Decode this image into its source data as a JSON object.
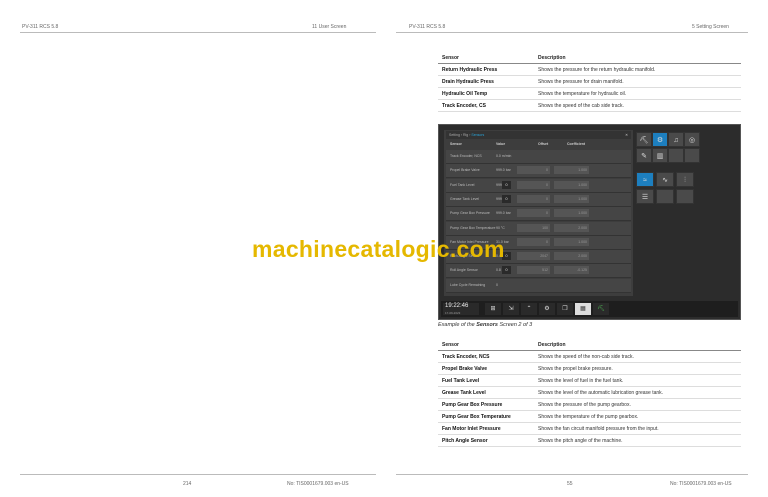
{
  "header": {
    "left_doc": "PV-311 RCS 5.8",
    "left_section": "11 User Screen",
    "right_doc": "PV-311 RCS 5.8",
    "right_section": "5 Setting Screen"
  },
  "table1": {
    "col_sensor": "Sensor",
    "col_desc": "Description",
    "rows": [
      {
        "sensor": "Return Hydraulic Press",
        "desc": "Shows the pressure for the return hydraulic manifold."
      },
      {
        "sensor": "Drain Hydraulic Press",
        "desc": "Shows the pressure for drain manifold."
      },
      {
        "sensor": "Hydraulic Oil Temp",
        "desc": "Shows the temperature for hydraulic oil."
      },
      {
        "sensor": "Track Encoder, CS",
        "desc": "Shows the speed of the cab side track."
      }
    ]
  },
  "screen": {
    "breadcrumb_prefix": "Setting › Rig ›",
    "breadcrumb_active": "Sensors",
    "col_sensor": "Sensor",
    "col_value": "Value",
    "col_offset": "Offset",
    "col_coeff": "Coefficient",
    "rows": [
      {
        "name": "Track Encoder, NCS",
        "value": "0.0 m/min",
        "offset": "",
        "coeff": "",
        "btn": ""
      },
      {
        "name": "Propel Brake Valve",
        "value": "999.0 bar",
        "offset": "0",
        "coeff": "1.000",
        "btn": ""
      },
      {
        "name": "Fuel Tank Level",
        "value": "999.0 %",
        "offset": "0",
        "coeff": "1.000",
        "btn": "0"
      },
      {
        "name": "Grease Tank Level",
        "value": "999.0 %",
        "offset": "0",
        "coeff": "1.000",
        "btn": "0"
      },
      {
        "name": "Pump Gear Box Pressure",
        "value": "999.0 bar",
        "offset": "0",
        "coeff": "1.000",
        "btn": ""
      },
      {
        "name": "Pump Gear Box Temperature",
        "value": "90 °C",
        "offset": "100",
        "coeff": "2.000",
        "btn": ""
      },
      {
        "name": "Fan Motor Inlet Pressure",
        "value": "31.0 bar",
        "offset": "0",
        "coeff": "1.000",
        "btn": ""
      },
      {
        "name": "Pitch Angle Sensor",
        "value": "0.4",
        "offset": "2047",
        "coeff": "2.000",
        "btn": "0"
      },
      {
        "name": "Roll Angle Sensor",
        "value": "0.8 °",
        "offset": "512",
        "coeff": "-0.125",
        "btn": "0"
      },
      {
        "name": "Lube Cycle Remaining",
        "value": "0",
        "offset": "",
        "coeff": "",
        "btn": ""
      }
    ],
    "clock_time": "19:22:46",
    "clock_date": "17-09-2023",
    "icons": {
      "tile1": "excavator-icon",
      "tile2": "gauge-settings-icon",
      "tile3": "bell-icon",
      "tile4": "globe-icon",
      "tile5": "wrench-icon",
      "tile6": "chart-icon",
      "tile7": "sensor-wave-icon",
      "tile8": "pulse-icon",
      "tile9": "sliders-icon",
      "tile10": "list-icon"
    }
  },
  "caption_prefix": "Example of the",
  "caption_bold": "Sensors",
  "caption_suffix": "Screen 2 of 3",
  "table2": {
    "col_sensor": "Sensor",
    "col_desc": "Description",
    "rows": [
      {
        "sensor": "Track Encoder, NCS",
        "desc": "Shows the speed of the non-cab side track."
      },
      {
        "sensor": "Propel Brake Valve",
        "desc": "Shows the propel brake pressure."
      },
      {
        "sensor": "Fuel Tank Level",
        "desc": "Shows the level of fuel in the fuel tank."
      },
      {
        "sensor": "Grease Tank Level",
        "desc": "Shows the level of the automatic lubrication grease tank."
      },
      {
        "sensor": "Pump Gear Box Pressure",
        "desc": "Shows the pressure of the pump gearbox."
      },
      {
        "sensor": "Pump Gear Box Temperature",
        "desc": "Shows the temperature of the pump gearbox."
      },
      {
        "sensor": "Fan Motor Inlet Pressure",
        "desc": "Shows the fan circuit manifold pressure from the input."
      },
      {
        "sensor": "Pitch Angle Sensor",
        "desc": "Shows the pitch angle of the machine."
      }
    ]
  },
  "footer": {
    "left_page": "214",
    "left_doc_no": "No: TIS0001679.003 en-US",
    "right_page": "55",
    "right_doc_no": "No: TIS0001679.003 en-US"
  },
  "watermark": "machinecatalogic.com",
  "colors": {
    "accent": "#1d7fbf",
    "watermark": "#e5b800",
    "screen_bg": "#2c2c2c"
  }
}
